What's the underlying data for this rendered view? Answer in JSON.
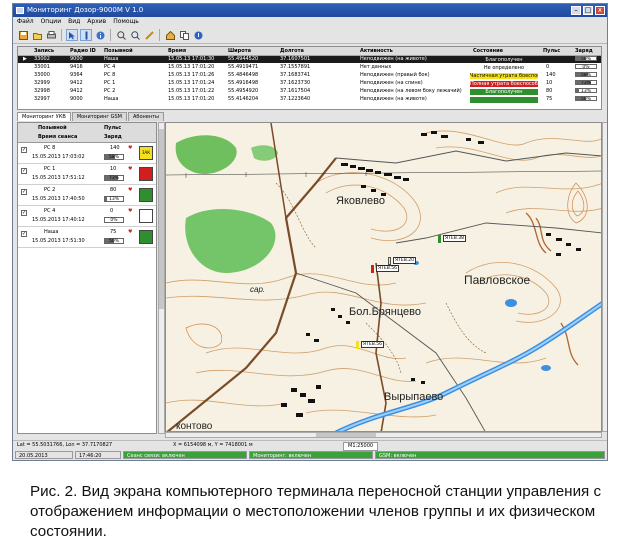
{
  "window": {
    "title": "Мониторинг Дозор-9000М V 1.0",
    "close_label": "x"
  },
  "menu": [
    "Файл",
    "Опции",
    "Вид",
    "Архив",
    "Помощь"
  ],
  "toolbar": [
    "save-icon",
    "open-icon",
    "print-icon",
    "pointer-icon",
    "cursor-icon",
    "info-icon",
    "zoom-in-icon",
    "zoom-out-icon",
    "pen-icon",
    "home-icon",
    "copy-icon",
    "help-icon"
  ],
  "units": {
    "columns": [
      "",
      "Запись",
      "Радио ID",
      "Позывной",
      "Время",
      "Широта",
      "Долгота",
      "Активность",
      "Состояние",
      "Пульс",
      "Заряд"
    ],
    "rows": [
      {
        "id": "33002",
        "radio": "9000",
        "call": "Наша",
        "time": "15.05.13 17:01:30",
        "lat": "55.4944520",
        "lon": "37.1607501",
        "activity": "Неподвижен (на животе)",
        "state": "Благополучен",
        "state_color": "#1a1a1a",
        "pulse": "",
        "charge": "50",
        "charge_text": "50%"
      },
      {
        "id": "33001",
        "radio": "9416",
        "call": "РС 4",
        "time": "15.05.13 17:01:20",
        "lat": "55.4919471",
        "lon": "37.1557891",
        "activity": "Нет данных",
        "state": "Не определено",
        "state_color": "#ffffff",
        "pulse": "0",
        "charge": "0",
        "charge_text": "0%"
      },
      {
        "id": "33000",
        "radio": "9364",
        "call": "РС 8",
        "time": "15.05.13 17:01:26",
        "lat": "55.4846498",
        "lon": "37.1683741",
        "activity": "Неподвижен (правый бок)",
        "state": "Частичная утрата боеспособности",
        "state_color": "#f4e11c",
        "pulse": "140",
        "charge": "58",
        "charge_text": "58%"
      },
      {
        "id": "32999",
        "radio": "9412",
        "call": "РС 1",
        "time": "15.05.13 17:01:24",
        "lat": "55.4916498",
        "lon": "37.1623730",
        "activity": "Неподвижен (на спине)",
        "state": "Полная утрата боеспособности",
        "state_color": "#d11f1f",
        "pulse": "10",
        "charge": "73",
        "charge_text": "73%"
      },
      {
        "id": "32998",
        "radio": "9412",
        "call": "РС 2",
        "time": "15.05.13 17:01:22",
        "lat": "55.4954920",
        "lon": "37.1617504",
        "activity": "Неподвижен (на левом боку лежачий)",
        "state": "Благополучен",
        "state_color": "#2f8f2f",
        "pulse": "80",
        "charge": "13",
        "charge_text": "13%"
      },
      {
        "id": "32997",
        "radio": "9000",
        "call": "Наша",
        "time": "15.05.13 17:01:20",
        "lat": "55.4146204",
        "lon": "37.1223640",
        "activity": "Неподвижен (на животе)",
        "state": "",
        "state_color": "#2f8f2f",
        "pulse": "75",
        "charge": "50",
        "charge_text": "50%"
      }
    ]
  },
  "tabs": [
    "Мониторинг УКВ",
    "Мониторинг GSM",
    "Абоненты"
  ],
  "left_panel": {
    "header": {
      "call": "Позывной",
      "session": "Время сеанса",
      "pulse": "Пульс",
      "charge": "Заряд"
    },
    "items": [
      {
        "call": "РС 8",
        "time": "15.05.2013 17:03:02",
        "pulse": "140",
        "charge": "58",
        "charge_text": "58%",
        "status_color": "#f4e11c",
        "badge": "ЗАК"
      },
      {
        "call": "РС 1",
        "time": "15.05.2013 17:51:12",
        "pulse": "10",
        "charge": "73",
        "charge_text": "73%",
        "status_color": "#d11f1f",
        "badge": ""
      },
      {
        "call": "РС 2",
        "time": "15.05.2013 17:40:50",
        "pulse": "80",
        "charge": "13",
        "charge_text": "13%",
        "status_color": "#2f8f2f",
        "badge": ""
      },
      {
        "call": "РС 4",
        "time": "15.05.2013 17:40:12",
        "pulse": "0",
        "charge": "0",
        "charge_text": "0%",
        "status_color": "#ffffff",
        "badge": ""
      },
      {
        "call": "Наша",
        "time": "15.05.2013 17:51:30",
        "pulse": "75",
        "charge": "50",
        "charge_text": "50%",
        "status_color": "#2f8f2f",
        "badge": ""
      }
    ]
  },
  "map": {
    "labels": {
      "yakovlevo": "Яковлево",
      "pavlovskoe": "Павловское",
      "bryantsevo": "Бол.Брянцево",
      "vyrypaevo": "Вырыпаево",
      "kontovo": "контово",
      "sar": "сар."
    },
    "markers": [
      {
        "label": "ЯТЕВ.38",
        "color": "#2f8f2f"
      },
      {
        "label": "ЯТЕВ.56",
        "color": "#d11f1f"
      },
      {
        "label": "ЯТЕВ.20",
        "color": "#e0e0e0"
      },
      {
        "label": "ЯТЕВ.56",
        "color": "#f4e11c"
      }
    ]
  },
  "coords": {
    "latlon": "Lat = 55.5031766, Lon = 37.7170827",
    "xy": "X = 6154098 м, Y = 7418001 м",
    "scale": "М1:25000"
  },
  "status": {
    "date": "20.05.2013",
    "time": "17:46:20",
    "s1": "Сеанс связи: включен",
    "s2": "Мониторинг: включен",
    "s3": "GSM: включен"
  },
  "caption": "Рис. 2. Вид экрана компьютерного терминала переносной станции управления с отображением информации о местоположении членов группы и их физическом состоянии.",
  "colors": {
    "accent": "#2f5fb3",
    "ok": "#2f8f2f",
    "warn": "#f4e11c",
    "alarm": "#d11f1f",
    "status_green": "#3ba13b"
  }
}
